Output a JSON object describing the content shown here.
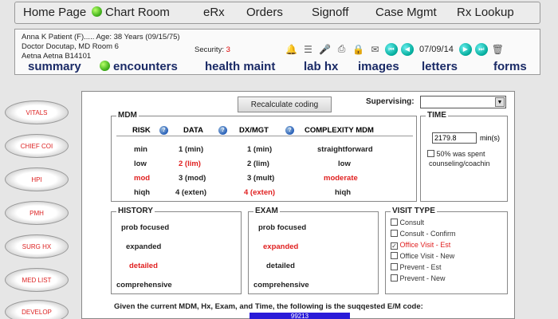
{
  "nav": {
    "home": "Home Page",
    "chart_room": "Chart Room",
    "erx": "eRx",
    "orders": "Orders",
    "signoff": "Signoff",
    "case_mgmt": "Case Mgmt",
    "rx_lookup": "Rx Lookup"
  },
  "patient": {
    "line1": "Anna K Patient (F)..... Age: 38 Years (09/15/75)",
    "line2": "Doctor Docutap, MD  Room 6",
    "line3": "Aetna Aetna B14101",
    "security_label": "Security:",
    "security_value": "3",
    "date": "07/09/14"
  },
  "tabs": {
    "summary": "summary",
    "encounters": "encounters",
    "health_maint": "health maint",
    "lab_hx": "lab hx",
    "images": "images",
    "letters": "letters",
    "forms": "forms"
  },
  "sidebar": [
    "VITALS",
    "CHIEF COI",
    "HPI",
    "PMH",
    "SURG HX",
    "MED LIST",
    "DEVELOP"
  ],
  "main": {
    "recalc": "Recalculate coding",
    "supervising": "Supervising:",
    "mdm_legend": "MDM",
    "mdm_headers": {
      "risk": "RISK",
      "data": "DATA",
      "dxmgt": "DX/MGT",
      "complexity": "COMPLEXITY MDM"
    },
    "mdm_rows": [
      {
        "risk": "min",
        "data": "1 (min)",
        "dx": "1 (min)",
        "complexity": "straightforward"
      },
      {
        "risk": "low",
        "data": "2 (lim)",
        "dx": "2 (lim)",
        "complexity": "low"
      },
      {
        "risk": "mod",
        "data": "3 (mod)",
        "dx": "3 (mult)",
        "complexity": "moderate"
      },
      {
        "risk": "hiqh",
        "data": "4 (exten)",
        "dx": "4 (exten)",
        "complexity": "hiqh"
      }
    ],
    "time_legend": "TIME",
    "time_value": "2179.8",
    "time_unit": "min(s)",
    "time_cb1": "50% was spent",
    "time_cb2": "counseling/coachin",
    "history_legend": "HISTORY",
    "history_opts": [
      "prob focused",
      "expanded",
      "detailed",
      "comprehensive"
    ],
    "exam_legend": "EXAM",
    "exam_opts": [
      "prob focused",
      "expanded",
      "detailed",
      "comprehensive"
    ],
    "visit_legend": "VISIT TYPE",
    "visit_opts": [
      "Consult",
      "Consult - Confirm",
      "Office Visit - Est",
      "Office Visit - New",
      "Prevent - Est",
      "Prevent - New"
    ],
    "suggest": "Given the current MDM, Hx, Exam, and Time, the following is the suqqested E/M code:",
    "em_code": "99213"
  },
  "colors": {
    "selected": "#e02020",
    "tab_text": "#1a2a66",
    "code_bar": "#2a1bd8"
  }
}
